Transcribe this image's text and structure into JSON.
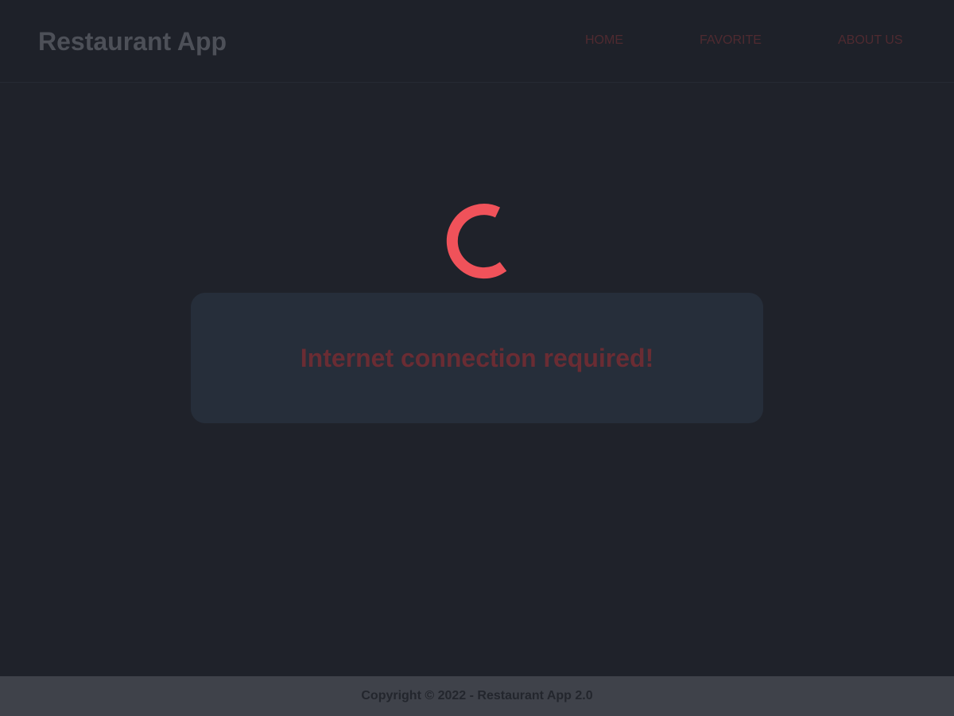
{
  "header": {
    "brand": "Restaurant App",
    "nav": [
      {
        "label": "HOME"
      },
      {
        "label": "FAVORITE"
      },
      {
        "label": "ABOUT US"
      }
    ]
  },
  "main": {
    "offline_message": "Internet connection required!",
    "loading_icon": "spinner-icon"
  },
  "footer": {
    "copyright": "Copyright © 2022 - Restaurant App 2.0"
  },
  "colors": {
    "background": "#1f222a",
    "accent": "#f0525a",
    "card": "#262e3a",
    "footer": "#3f424a"
  }
}
